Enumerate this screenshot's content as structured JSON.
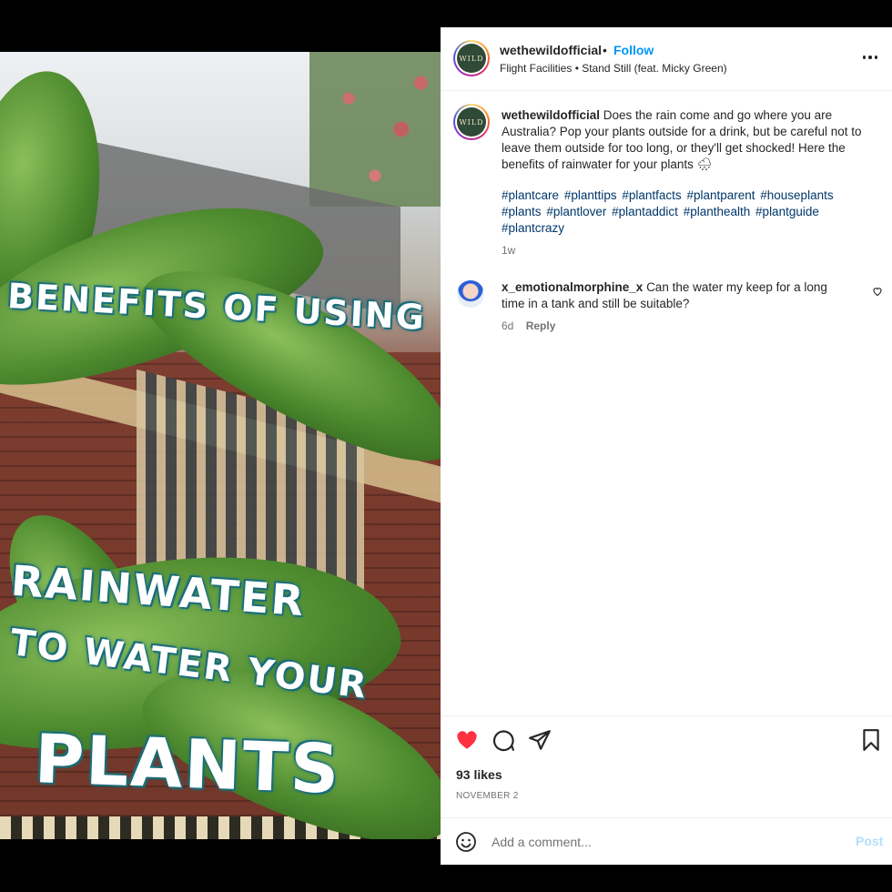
{
  "media": {
    "overlay_lines": [
      "BENEFITS OF USING",
      "RAINWATER",
      "TO WATER YOUR",
      "PLANTS"
    ],
    "mute_icon": "speaker-muted-icon"
  },
  "header": {
    "username": "wethewildofficial",
    "separator": "•",
    "follow_label": "Follow",
    "audio": "Flight Facilities • Stand Still (feat. Micky Green)",
    "avatar_text": "WILD",
    "more_icon": "more-options-icon"
  },
  "caption": {
    "username": "wethewildofficial",
    "text": "Does the rain come and go where you are Australia? Pop your plants outside for a drink, but be careful not to leave them outside for too long, or they'll get shocked! Here the benefits of rainwater for your plants 🌧",
    "hashtags": [
      "#plantcare",
      "#planttips",
      "#plantfacts",
      "#plantparent",
      "#houseplants",
      "#plants",
      "#plantlover",
      "#plantaddict",
      "#planthealth",
      "#plantguide",
      "#plantcrazy"
    ],
    "time": "1w"
  },
  "comment": {
    "username": "x_emotionalmorphine_x",
    "text": "Can the water my keep for a long time in a tank and still be suitable?",
    "time": "6d",
    "reply_label": "Reply"
  },
  "actions": {
    "likes": "93 likes",
    "date": "NOVEMBER 2",
    "liked": true,
    "like_color": "#ff3040"
  },
  "add_comment": {
    "placeholder": "Add a comment...",
    "post_label": "Post"
  }
}
